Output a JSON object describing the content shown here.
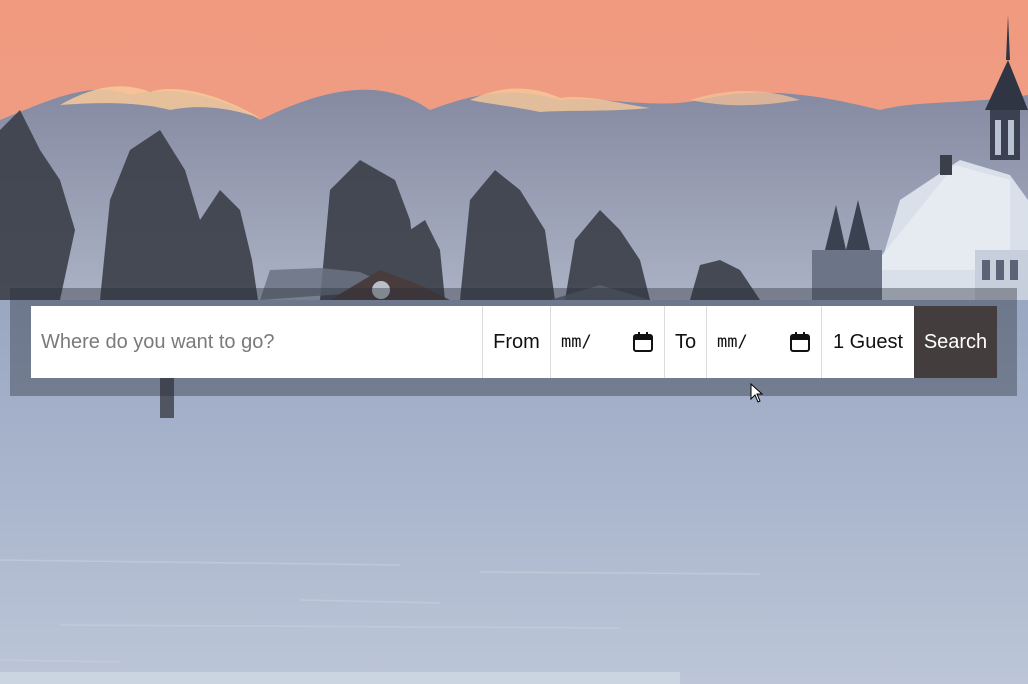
{
  "search": {
    "placeholder": "Where do you want to go?",
    "from_label": "From",
    "from_value": "mm/",
    "to_label": "To",
    "to_value": "mm/",
    "guests": "1 Guest",
    "submit_label": "Search"
  },
  "colors": {
    "sky_top": "#f39c80",
    "sky_bottom": "#e8a58d",
    "clouds": "#8f9bb4",
    "ice": "#aab7cf",
    "search_button": "#433d3e",
    "input_background": "#ffffff"
  },
  "icons": {
    "from_date": "calendar-icon",
    "to_date": "calendar-icon",
    "pointer": "mouse-cursor-icon"
  }
}
